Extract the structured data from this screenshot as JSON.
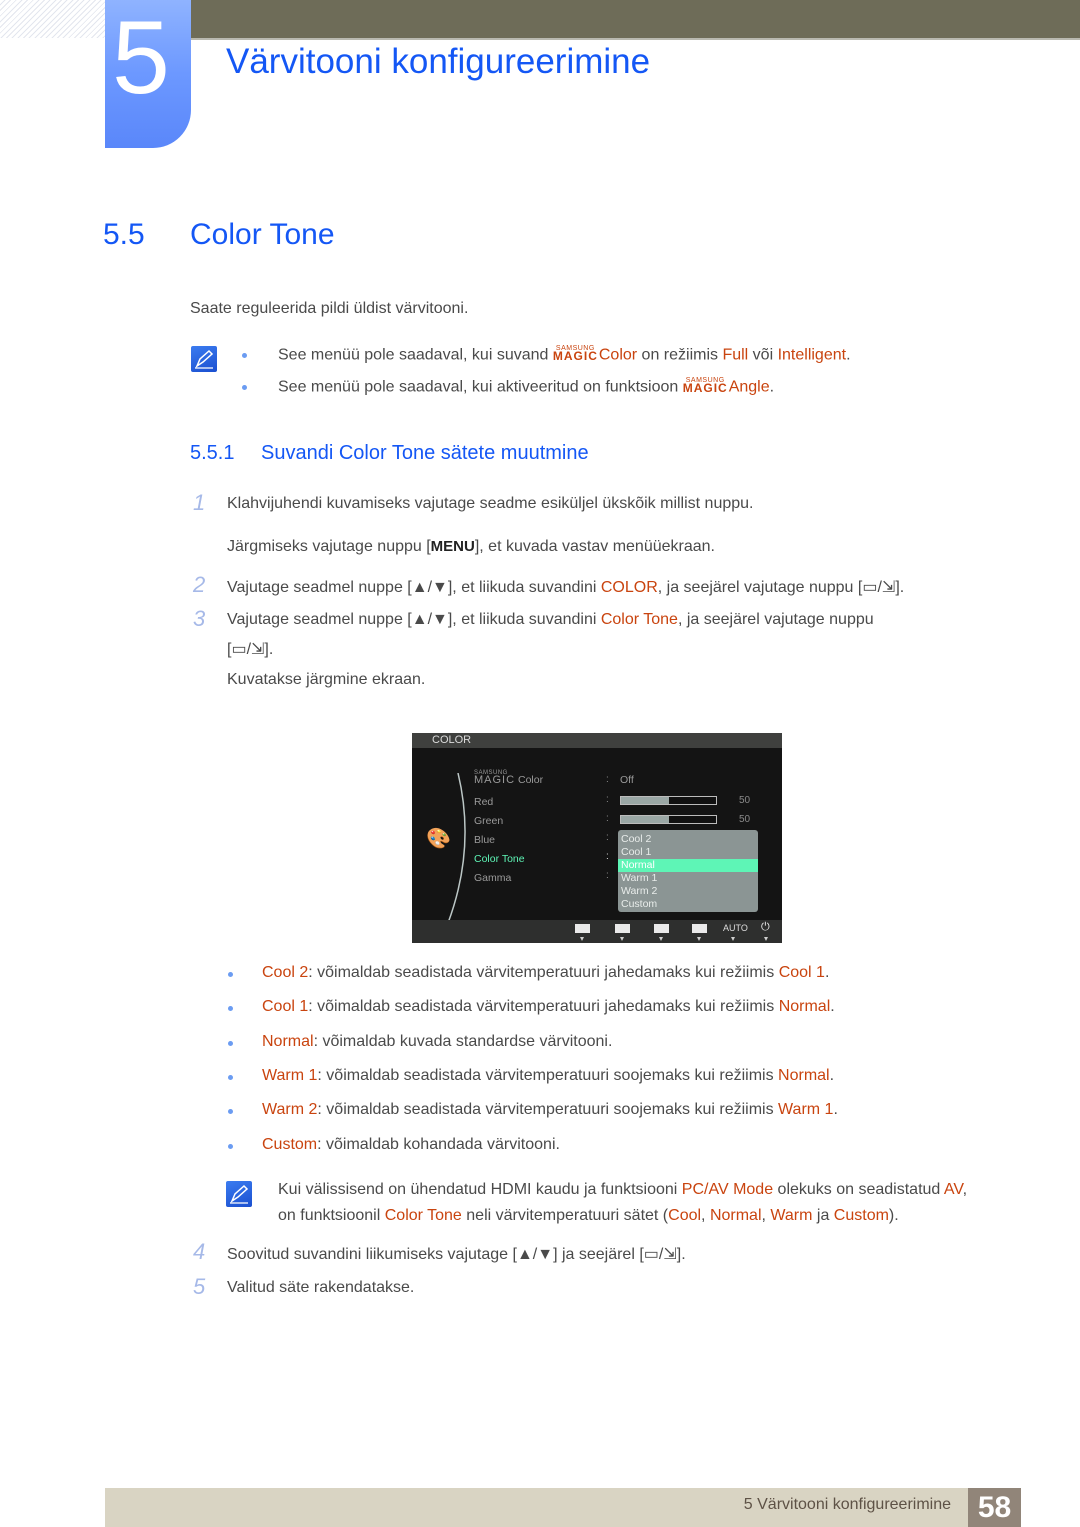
{
  "header": {
    "chapter_number": "5",
    "chapter_title": "Värvitooni konfigureerimine"
  },
  "section": {
    "number": "5.5",
    "title": "Color Tone",
    "intro": "Saate reguleerida pildi üldist värvitooni."
  },
  "notes_top": [
    {
      "pre": "See menüü pole saadaval, kui suvand ",
      "magic_top": "SAMSUNG",
      "magic_bottom": "MAGIC",
      "magic_word": "Color",
      "mid": " on režiimis ",
      "hl1": "Full",
      "mid2": " või ",
      "hl2": "Intelligent",
      "end": "."
    },
    {
      "pre": "See menüü pole saadaval, kui aktiveeritud on funktsioon ",
      "magic_top": "SAMSUNG",
      "magic_bottom": "MAGIC",
      "magic_word": "Angle",
      "end": "."
    }
  ],
  "subsection": {
    "number": "5.5.1",
    "title": "Suvandi Color Tone sätete muutmine"
  },
  "steps": {
    "s1": {
      "num": "1",
      "text": "Klahvijuhendi kuvamiseks vajutage seadme esiküljel ükskõik millist nuppu.",
      "text2_pre": "Järgmiseks vajutage nuppu [",
      "text2_key": "MENU",
      "text2_post": "], et kuvada vastav menüüekraan."
    },
    "s2": {
      "num": "2",
      "pre": "Vajutage seadmel nuppe [",
      "mid": "], et liikuda suvandini ",
      "hl": "COLOR",
      "post": ", ja seejärel vajutage nuppu [",
      "end": "]."
    },
    "s3": {
      "num": "3",
      "pre": "Vajutage seadmel nuppe [",
      "mid": "], et liikuda suvandini ",
      "hl": "Color Tone",
      "post": ", ja seejärel vajutage nuppu",
      "line2_pre": "[",
      "line2_end": "].",
      "after": "Kuvatakse järgmine ekraan."
    },
    "s4": {
      "num": "4",
      "pre": "Soovitud suvandini liikumiseks vajutage [",
      "mid": "] ja seejärel [",
      "end": "]."
    },
    "s5": {
      "num": "5",
      "text": "Valitud säte rakendatakse."
    }
  },
  "osd": {
    "title": "COLOR",
    "items": [
      {
        "label_top": "SAMSUNG",
        "label_bottom": "MAGIC",
        "label": "Color",
        "value": "Off"
      },
      {
        "label": "Red",
        "value": "50",
        "level": 0.5
      },
      {
        "label": "Green",
        "value": "50",
        "level": 0.5
      },
      {
        "label": "Blue"
      },
      {
        "label": "Color Tone",
        "active": true
      },
      {
        "label": "Gamma"
      }
    ],
    "dropdown": [
      "Cool 2",
      "Cool 1",
      "Normal",
      "Warm 1",
      "Warm 2",
      "Custom"
    ],
    "selected": "Normal",
    "footer_buttons": [
      "left-icon",
      "down-icon",
      "up-icon",
      "enter-icon",
      "AUTO",
      "power-icon"
    ],
    "auto_label": "AUTO",
    "active_color": "#5ef5b6"
  },
  "tone_list": [
    {
      "name": "Cool 2",
      "desc": ": võimaldab seadistada värvitemperatuuri jahedamaks kui režiimis ",
      "ref": "Cool 1",
      "end": "."
    },
    {
      "name": "Cool 1",
      "desc": ": võimaldab seadistada värvitemperatuuri jahedamaks kui režiimis ",
      "ref": "Normal",
      "end": "."
    },
    {
      "name": "Normal",
      "desc": ": võimaldab kuvada standardse värvitooni."
    },
    {
      "name": "Warm 1",
      "desc": ": võimaldab seadistada värvitemperatuuri soojemaks kui režiimis ",
      "ref": "Normal",
      "end": "."
    },
    {
      "name": "Warm 2",
      "desc": ": võimaldab seadistada värvitemperatuuri soojemaks kui režiimis ",
      "ref": "Warm 1",
      "end": "."
    },
    {
      "name": "Custom",
      "desc": ": võimaldab kohandada värvitooni."
    }
  ],
  "note_bottom": {
    "l1_pre": "Kui välissisend on ühendatud HDMI kaudu ja funktsiooni ",
    "l1_hl1": "PC/AV Mode",
    "l1_mid": " olekuks on seadistatud ",
    "l1_hl2": "AV",
    "l1_end": ",",
    "l2_pre": "on funktsioonil ",
    "l2_hl1": "Color Tone",
    "l2_mid": " neli värvitemperatuuri sätet (",
    "l2_hl2": "Cool",
    "l2_c1": ", ",
    "l2_hl3": "Normal",
    "l2_c2": ", ",
    "l2_hl4": "Warm",
    "l2_ja": " ja ",
    "l2_hl5": "Custom",
    "l2_end": ")."
  },
  "footer": {
    "text": "5 Värvitooni konfigureerimine",
    "page": "58"
  },
  "colors": {
    "accent_blue": "#1457f5",
    "highlight": "#c9440f",
    "osd_active": "#5ef5b6"
  }
}
